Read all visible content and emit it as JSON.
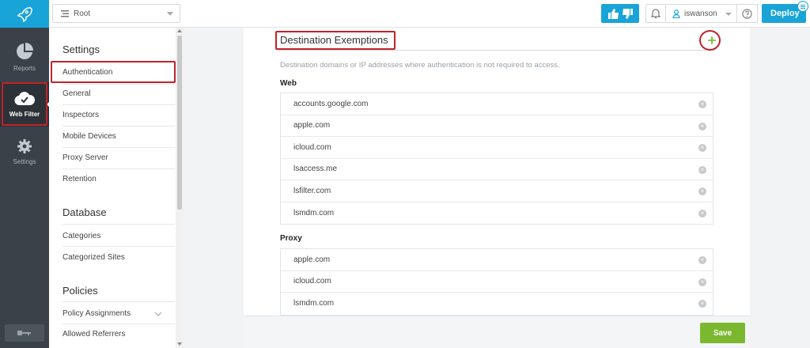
{
  "rail": {
    "items": [
      {
        "label": "Reports",
        "icon": "pie-chart-icon"
      },
      {
        "label": "Web Filter",
        "icon": "cloud-check-icon"
      },
      {
        "label": "Settings",
        "icon": "gear-icon"
      }
    ]
  },
  "topbar": {
    "root_label": "Root",
    "username": "iswanson",
    "deploy_label": "Deploy"
  },
  "sidebar": {
    "sections": [
      {
        "title": "Settings",
        "items": [
          "Authentication",
          "General",
          "Inspectors",
          "Mobile Devices",
          "Proxy Server",
          "Retention"
        ]
      },
      {
        "title": "Database",
        "items": [
          "Categories",
          "Categorized Sites"
        ]
      },
      {
        "title": "Policies",
        "items": [
          "Policy Assignments",
          "Allowed Referrers"
        ]
      }
    ]
  },
  "main": {
    "title": "Destination Exemptions",
    "description": "Destination domains or IP addresses where authentication is not required to access.",
    "web": {
      "label": "Web",
      "domains": [
        "accounts.google.com",
        "apple.com",
        "icloud.com",
        "lsaccess.me",
        "lsfilter.com",
        "lsmdm.com"
      ]
    },
    "proxy": {
      "label": "Proxy",
      "domains": [
        "apple.com",
        "icloud.com",
        "lsmdm.com"
      ]
    },
    "save_label": "Save"
  },
  "colors": {
    "accent": "#19a4d8",
    "rail": "#3a4149",
    "highlight": "#c0232a",
    "save": "#7cb82f"
  }
}
